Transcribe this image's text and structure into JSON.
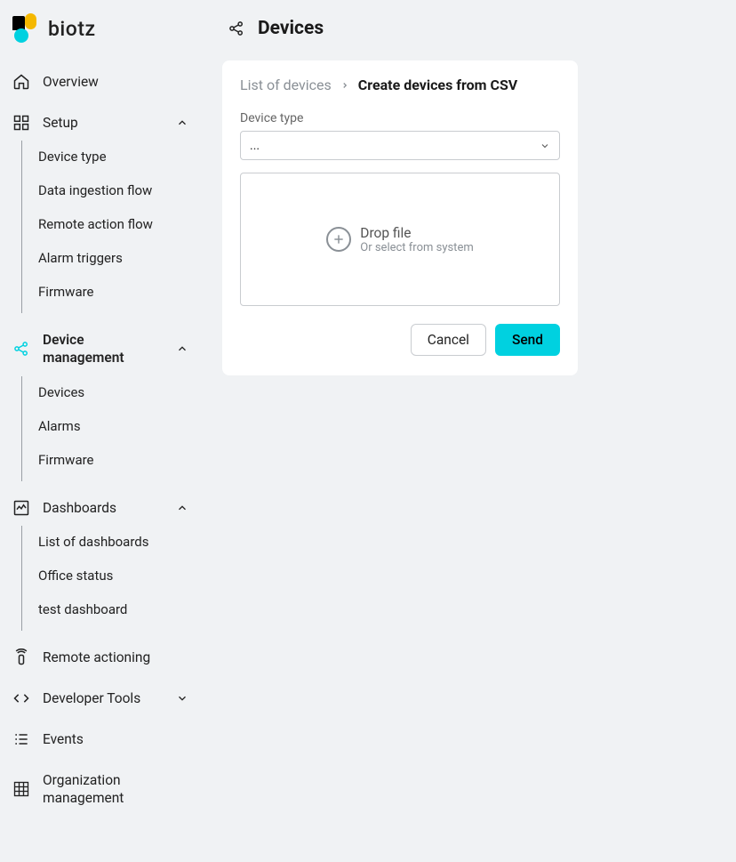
{
  "brand": {
    "name": "biotz"
  },
  "sidebar": {
    "overview": "Overview",
    "setup": {
      "label": "Setup",
      "items": [
        "Device type",
        "Data ingestion flow",
        "Remote action flow",
        "Alarm triggers",
        "Firmware"
      ]
    },
    "device_mgmt": {
      "label": "Device management",
      "items": [
        "Devices",
        "Alarms",
        "Firmware"
      ]
    },
    "dashboards": {
      "label": "Dashboards",
      "items": [
        "List of dashboards",
        "Office status",
        "test dashboard"
      ]
    },
    "remote_actioning": "Remote actioning",
    "dev_tools": "Developer Tools",
    "events": "Events",
    "org_mgmt": "Organization management"
  },
  "page": {
    "title": "Devices",
    "breadcrumb_prev": "List of devices",
    "breadcrumb_current": "Create devices from CSV",
    "device_type_label": "Device type",
    "device_type_value": "...",
    "drop_main": "Drop file",
    "drop_sub": "Or select from system",
    "cancel": "Cancel",
    "send": "Send"
  }
}
